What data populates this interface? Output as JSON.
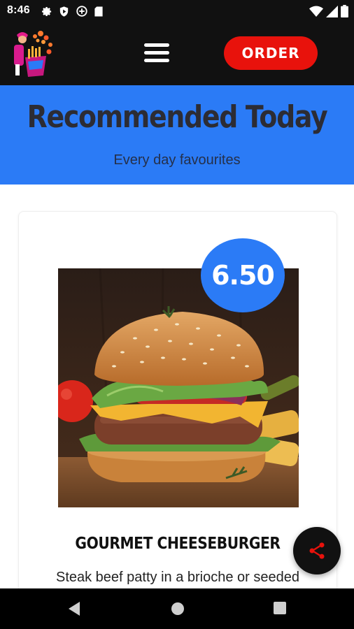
{
  "status_bar": {
    "time": "8:46",
    "left_icons": [
      "gear-icon",
      "play-shield-icon",
      "vpn-icon",
      "sd-card-icon"
    ],
    "right_icons": [
      "wifi-icon",
      "signal-icon",
      "battery-icon"
    ]
  },
  "header": {
    "logo": "brand-logo",
    "menu_icon": "hamburger-menu-icon",
    "order_label": "ORDER",
    "colors": {
      "background": "#111111",
      "order_button": "#e8120c"
    }
  },
  "hero": {
    "title": "Recommended Today",
    "subtitle": "Every day favourites",
    "background": "#2b7bf6"
  },
  "product": {
    "price": "6.50",
    "name": "GOURMET CHEESEBURGER",
    "description": "Steak beef patty in a brioche or seeded",
    "image": "cheeseburger-photo"
  },
  "fab": {
    "icon": "share-icon",
    "icon_color": "#e8120c"
  },
  "nav_bar": {
    "buttons": [
      "back-icon",
      "home-icon",
      "recents-icon"
    ]
  }
}
